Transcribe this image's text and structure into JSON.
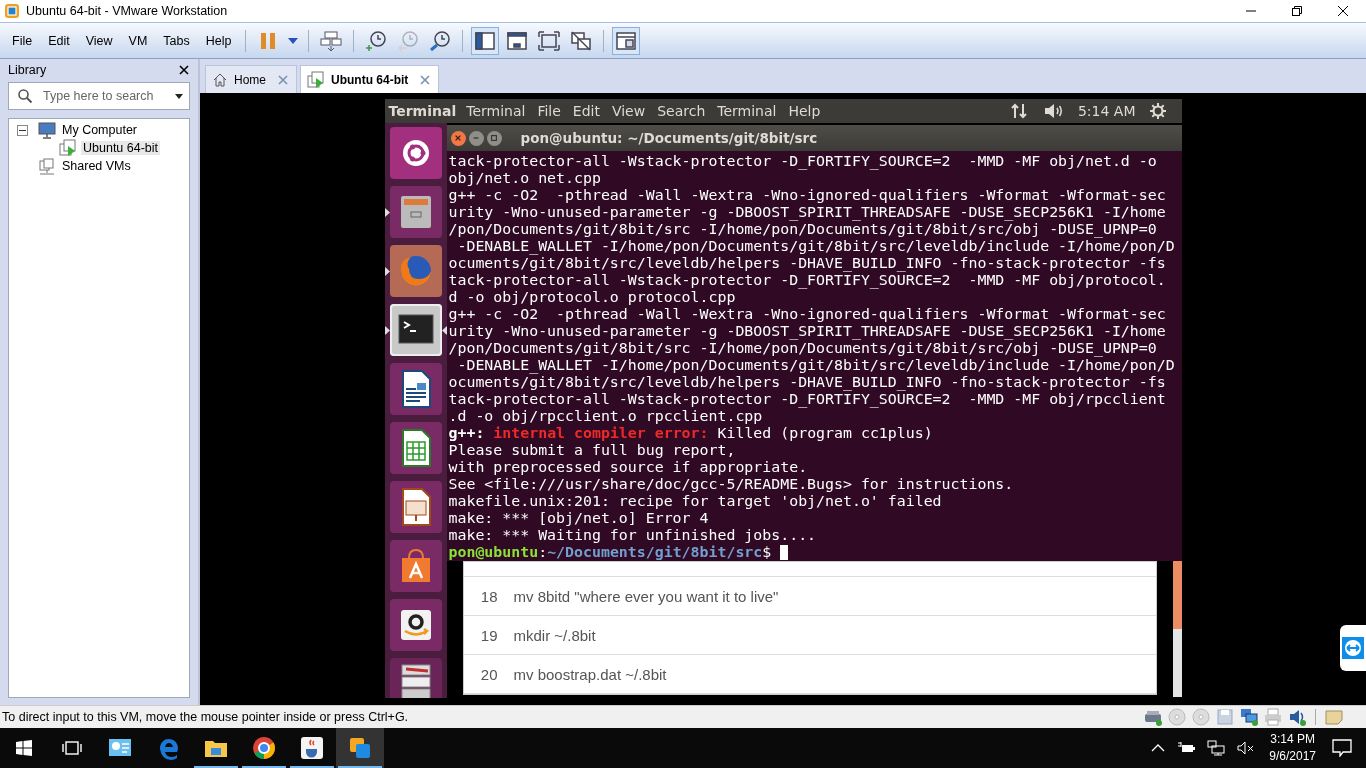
{
  "window": {
    "title": "Ubuntu 64-bit - VMware Workstation"
  },
  "menu": [
    "File",
    "Edit",
    "View",
    "VM",
    "Tabs",
    "Help"
  ],
  "toolbar": [
    [
      {
        "kind": "pause",
        "selected": false,
        "disabled": false
      },
      {
        "kind": "dropdown",
        "selected": false,
        "disabled": false
      }
    ],
    [
      {
        "kind": "send-keys",
        "selected": false,
        "disabled": false
      }
    ],
    [
      {
        "kind": "snapshot",
        "selected": false,
        "disabled": false
      },
      {
        "kind": "revert",
        "selected": false,
        "disabled": true
      },
      {
        "kind": "snapshot-manager",
        "selected": false,
        "disabled": false
      }
    ],
    [
      {
        "kind": "library-view",
        "selected": true,
        "disabled": false
      },
      {
        "kind": "thumbnail-view",
        "selected": false,
        "disabled": false
      },
      {
        "kind": "fullscreen",
        "selected": false,
        "disabled": false
      },
      {
        "kind": "unity",
        "selected": false,
        "disabled": false
      }
    ],
    [
      {
        "kind": "console-view",
        "selected": true,
        "disabled": false
      }
    ]
  ],
  "library": {
    "title": "Library",
    "search": {
      "placeholder": "Type here to search"
    },
    "tree": [
      {
        "label": "My Computer",
        "kind": "computer",
        "expanded": true,
        "selected": false,
        "children": [
          {
            "label": "Ubuntu 64-bit",
            "kind": "vm",
            "selected": true
          }
        ]
      },
      {
        "label": "Shared VMs",
        "kind": "shared",
        "selected": false
      }
    ]
  },
  "tabs": [
    {
      "label": "Home",
      "kind": "home",
      "selected": false
    },
    {
      "label": "Ubuntu 64-bit",
      "kind": "vm",
      "selected": true
    }
  ],
  "vm": {
    "panel": {
      "app": "Terminal",
      "menu": [
        "Terminal",
        "File",
        "Edit",
        "View",
        "Search",
        "Terminal",
        "Help"
      ],
      "clock": "5:14 AM"
    },
    "launcher": [
      {
        "kind": "ubuntu",
        "running": false,
        "focused": false
      },
      {
        "kind": "files",
        "running": true,
        "focused": false
      },
      {
        "kind": "firefox",
        "running": true,
        "focused": false
      },
      {
        "kind": "terminal",
        "running": true,
        "focused": true
      },
      {
        "kind": "writer",
        "running": false,
        "focused": false
      },
      {
        "kind": "calc",
        "running": false,
        "focused": false
      },
      {
        "kind": "impress",
        "running": false,
        "focused": false
      },
      {
        "kind": "software",
        "running": false,
        "focused": false
      },
      {
        "kind": "amazon",
        "running": false,
        "focused": false
      },
      {
        "kind": "stack",
        "running": false,
        "focused": false
      }
    ],
    "terminal": {
      "title": "pon@ubuntu: ~/Documents/git/8bit/src",
      "lines": [
        {
          "kind": "plain",
          "text": "tack-protector-all -Wstack-protector -D_FORTIFY_SOURCE=2  -MMD -MF obj/net.d -o"
        },
        {
          "kind": "plain",
          "text": "obj/net.o net.cpp"
        },
        {
          "kind": "plain",
          "text": "g++ -c -O2  -pthread -Wall -Wextra -Wno-ignored-qualifiers -Wformat -Wformat-sec"
        },
        {
          "kind": "plain",
          "text": "urity -Wno-unused-parameter -g -DBOOST_SPIRIT_THREADSAFE -DUSE_SECP256K1 -I/home"
        },
        {
          "kind": "plain",
          "text": "/pon/Documents/git/8bit/src -I/home/pon/Documents/git/8bit/src/obj -DUSE_UPNP=0"
        },
        {
          "kind": "plain",
          "text": " -DENABLE_WALLET -I/home/pon/Documents/git/8bit/src/leveldb/include -I/home/pon/D"
        },
        {
          "kind": "plain",
          "text": "ocuments/git/8bit/src/leveldb/helpers -DHAVE_BUILD_INFO -fno-stack-protector -fs"
        },
        {
          "kind": "plain",
          "text": "tack-protector-all -Wstack-protector -D_FORTIFY_SOURCE=2  -MMD -MF obj/protocol."
        },
        {
          "kind": "plain",
          "text": "d -o obj/protocol.o protocol.cpp"
        },
        {
          "kind": "plain",
          "text": "g++ -c -O2  -pthread -Wall -Wextra -Wno-ignored-qualifiers -Wformat -Wformat-sec"
        },
        {
          "kind": "plain",
          "text": "urity -Wno-unused-parameter -g -DBOOST_SPIRIT_THREADSAFE -DUSE_SECP256K1 -I/home"
        },
        {
          "kind": "plain",
          "text": "/pon/Documents/git/8bit/src -I/home/pon/Documents/git/8bit/src/obj -DUSE_UPNP=0"
        },
        {
          "kind": "plain",
          "text": " -DENABLE_WALLET -I/home/pon/Documents/git/8bit/src/leveldb/include -I/home/pon/D"
        },
        {
          "kind": "plain",
          "text": "ocuments/git/8bit/src/leveldb/helpers -DHAVE_BUILD_INFO -fno-stack-protector -fs"
        },
        {
          "kind": "plain",
          "text": "tack-protector-all -Wstack-protector -D_FORTIFY_SOURCE=2  -MMD -MF obj/rpcclient"
        },
        {
          "kind": "plain",
          "text": ".d -o obj/rpcclient.o rpcclient.cpp"
        },
        {
          "kind": "error",
          "prefix": "g++:",
          "label": "internal compiler error:",
          "text": "Killed (program cc1plus)"
        },
        {
          "kind": "plain",
          "text": "Please submit a full bug report,"
        },
        {
          "kind": "plain",
          "text": "with preprocessed source if appropriate."
        },
        {
          "kind": "plain",
          "text": "See <file:///usr/share/doc/gcc-5/README.Bugs> for instructions."
        },
        {
          "kind": "plain",
          "text": "makefile.unix:201: recipe for target 'obj/net.o' failed"
        },
        {
          "kind": "plain",
          "text": "make: *** [obj/net.o] Error 4"
        },
        {
          "kind": "plain",
          "text": "make: *** Waiting for unfinished jobs...."
        },
        {
          "kind": "prompt",
          "user": "pon@ubuntu",
          "separator": ":",
          "path": "~/Documents/git/8bit/src",
          "symbol": "$"
        }
      ]
    },
    "page_rows": [
      {
        "number": "18",
        "command": "mv 8bitd \"where ever you want it to live\""
      },
      {
        "number": "19",
        "command": "mkdir ~/.8bit"
      },
      {
        "number": "20",
        "command": "mv boostrap.dat ~/.8bit"
      }
    ]
  },
  "status_bar": {
    "message": "To direct input to this VM, move the mouse pointer inside or press Ctrl+G.",
    "devices": [
      {
        "kind": "disk",
        "connected": true
      },
      {
        "kind": "cd",
        "connected": false
      },
      {
        "kind": "cd",
        "connected": false
      },
      {
        "kind": "floppy",
        "connected": false
      },
      {
        "kind": "network",
        "connected": true
      },
      {
        "kind": "printer",
        "connected": false
      },
      {
        "kind": "sound",
        "connected": true
      },
      {
        "kind": "messages",
        "connected": false
      }
    ]
  },
  "taskbar": {
    "apps": [
      {
        "kind": "control-panel",
        "running": false,
        "selected": false
      },
      {
        "kind": "edge",
        "running": false,
        "selected": false
      },
      {
        "kind": "explorer",
        "running": true,
        "selected": false
      },
      {
        "kind": "chrome",
        "running": true,
        "selected": false
      },
      {
        "kind": "java",
        "running": true,
        "selected": false
      },
      {
        "kind": "vmware",
        "running": true,
        "selected": true
      }
    ],
    "time": "3:14 PM",
    "date": "9/6/2017"
  }
}
